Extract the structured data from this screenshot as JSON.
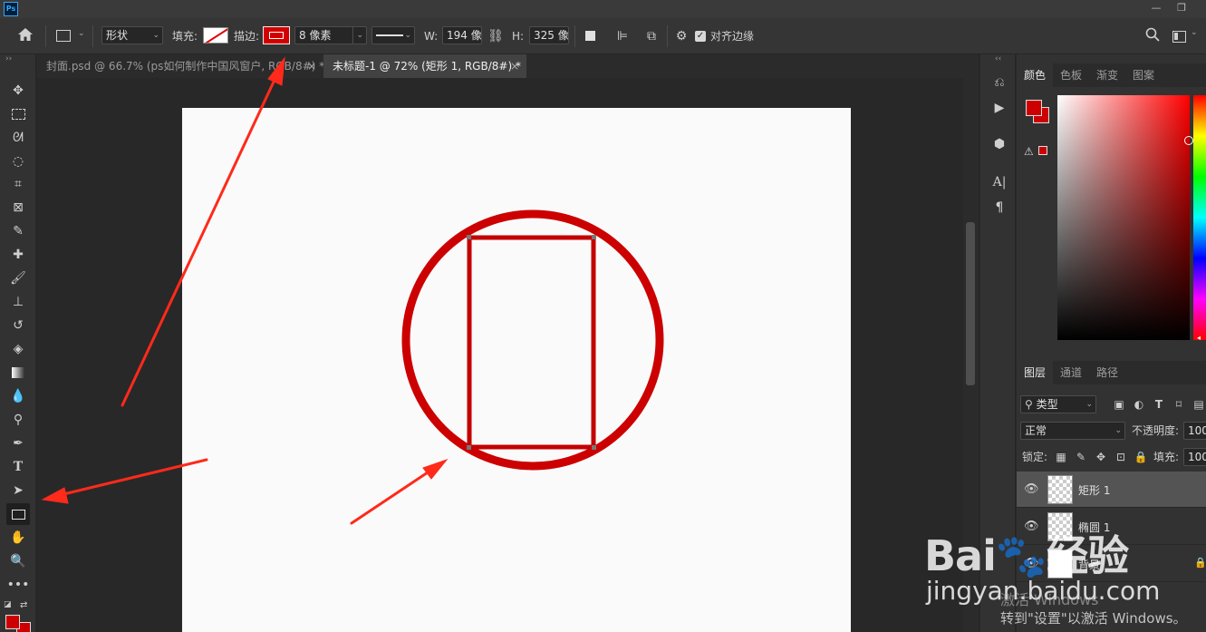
{
  "app": {
    "logo": "Ps",
    "window_controls": [
      "—",
      "❐"
    ]
  },
  "options_bar": {
    "home_icon": "home-icon",
    "mode": "形状",
    "fill_label": "填充:",
    "stroke_label": "描边:",
    "stroke_width": "8 像素",
    "w_label": "W:",
    "w_value": "194 像",
    "h_label": "H:",
    "h_value": "325 像",
    "align_edges_label": "对齐边缘",
    "align_edges_checked": true,
    "stroke_color": "#cc0000"
  },
  "tabs": [
    {
      "label": "封面.psd @ 66.7% (ps如何制作中国风窗户, RGB/8#) *",
      "close": "×",
      "active": false
    },
    {
      "label": "未标题-1 @ 72% (矩形 1, RGB/8#) *",
      "close": "×",
      "active": true
    }
  ],
  "canvas": {
    "shape_stroke_color": "#cc0000",
    "ellipse_layer": "椭圆 1",
    "rectangle_layer": "矩形 1"
  },
  "color_panel": {
    "tabs": [
      "颜色",
      "色板",
      "渐变",
      "图案"
    ],
    "active_tab": "颜色",
    "foreground": "#cc0000",
    "background": "#cc0000"
  },
  "layers_panel": {
    "tabs": [
      "图层",
      "通道",
      "路径"
    ],
    "active_tab": "图层",
    "filter_kind": "类型",
    "blend_mode": "正常",
    "opacity_label": "不透明度:",
    "opacity_value": "100",
    "lock_label": "锁定:",
    "fill_label": "填充:",
    "fill_value": "100",
    "layers": [
      {
        "name": "矩形 1",
        "selected": true
      },
      {
        "name": "椭圆 1",
        "selected": false
      },
      {
        "name": "背景",
        "selected": false
      }
    ]
  },
  "watermark": {
    "brand": "Bai🐾经验",
    "url": "jingyan.baidu.com",
    "activate_line1": "激活 Windows",
    "activate_line2": "转到\"设置\"以激活 Windows。"
  }
}
